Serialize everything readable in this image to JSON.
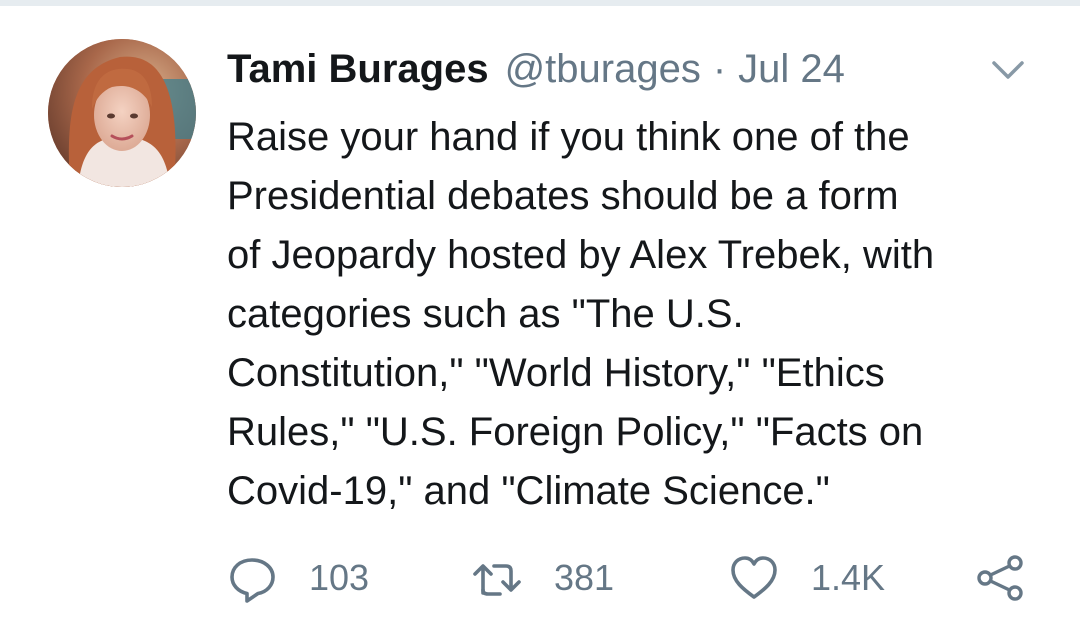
{
  "tweet": {
    "author": {
      "display_name": "Tami Burages",
      "handle": "@tburages",
      "avatar_icon": "profile-photo"
    },
    "separator": "·",
    "date": "Jul 24",
    "text": "Raise your hand if you think one of the\nPresidential debates should be a form\nof Jeopardy hosted by Alex Trebek, with\ncategories such as \"The U.S.\nConstitution,\" \"World History,\" \"Ethics\nRules,\" \"U.S. Foreign Policy,\" \"Facts on\nCovid-19,\" and \"Climate Science.\"",
    "actions": {
      "reply": {
        "icon": "reply-icon",
        "count": "103"
      },
      "retweet": {
        "icon": "retweet-icon",
        "count": "381"
      },
      "like": {
        "icon": "heart-icon",
        "count": "1.4K"
      },
      "share": {
        "icon": "share-icon"
      }
    },
    "menu_icon": "chevron-down-icon"
  },
  "colors": {
    "text_primary": "#14171a",
    "text_secondary": "#657786",
    "divider": "#e6ecf0"
  }
}
